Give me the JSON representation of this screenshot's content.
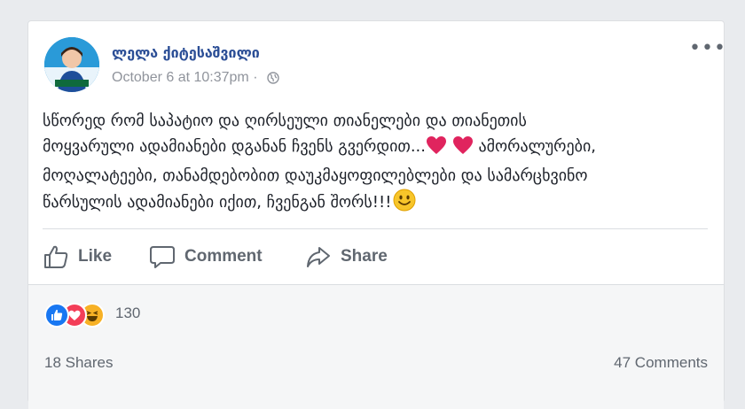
{
  "post": {
    "author": "ლელა ქიტესაშვილი",
    "timestamp": "October 6 at 10:37pm",
    "separator": "·",
    "privacy_icon": "globe-icon",
    "more_label": "•••",
    "text_lines": [
      "სწორედ რომ საპატიო და ღირსეული თიანელები და თიანეთის",
      "მოყვარული ადამიანები დგანან ჩვენს გვერდით...",
      " ამორალურები,",
      "მოღალატეები, თანამდებობით დაუკმაყოფილებლები და სამარცხვინო",
      "წარსულის ადამიანები იქით, ჩვენგან შორს!!!"
    ],
    "emojis": [
      "red-heart",
      "red-heart",
      "slightly-smiling-face"
    ]
  },
  "actions": {
    "like": "Like",
    "comment": "Comment",
    "share": "Share"
  },
  "stats": {
    "reaction_icons": [
      "like",
      "love",
      "haha"
    ],
    "reaction_count": "130",
    "shares": "18 Shares",
    "comments": "47 Comments"
  },
  "colors": {
    "author": "#2b4e96",
    "like": "#1877f2",
    "love": "#f33e58",
    "haha": "#f7b125",
    "muted": "#606770"
  }
}
